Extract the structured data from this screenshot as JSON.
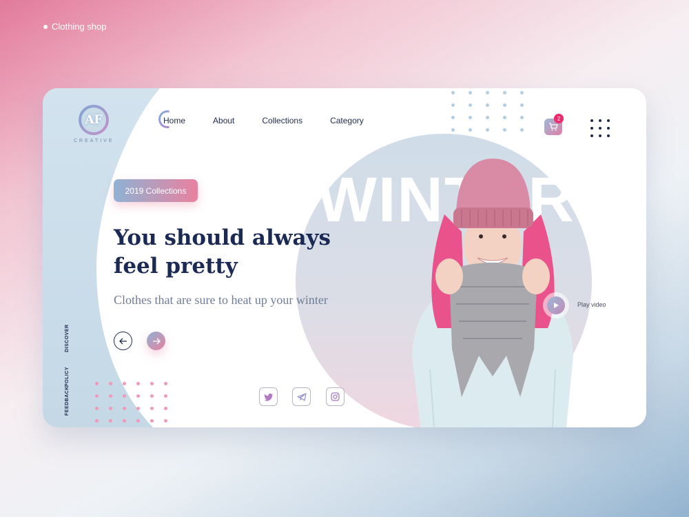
{
  "caption": {
    "text": "Clothing shop"
  },
  "logo": {
    "mark": "AF",
    "word": "CREATIVE",
    "tagline": ""
  },
  "nav": {
    "items": [
      {
        "label": "Home"
      },
      {
        "label": "About"
      },
      {
        "label": "Collections"
      },
      {
        "label": "Category"
      }
    ]
  },
  "cart": {
    "count": "2"
  },
  "hero": {
    "badge": "2019 Collections",
    "headline_line1": "You should always",
    "headline_line2": "feel pretty",
    "subline": "Clothes that are sure to heat up your winter",
    "background_word": "WINTER"
  },
  "side_links": [
    "DISCOVER",
    "POLICY",
    "FEEDBACK"
  ],
  "video": {
    "label": "Play video"
  },
  "social": [
    "twitter-icon",
    "telegram-icon",
    "instagram-icon"
  ],
  "colors": {
    "accent_pink": "#e9819f",
    "accent_blue": "#8fb2d4",
    "navy": "#1b2a55",
    "badge_red": "#ef2a6c"
  }
}
